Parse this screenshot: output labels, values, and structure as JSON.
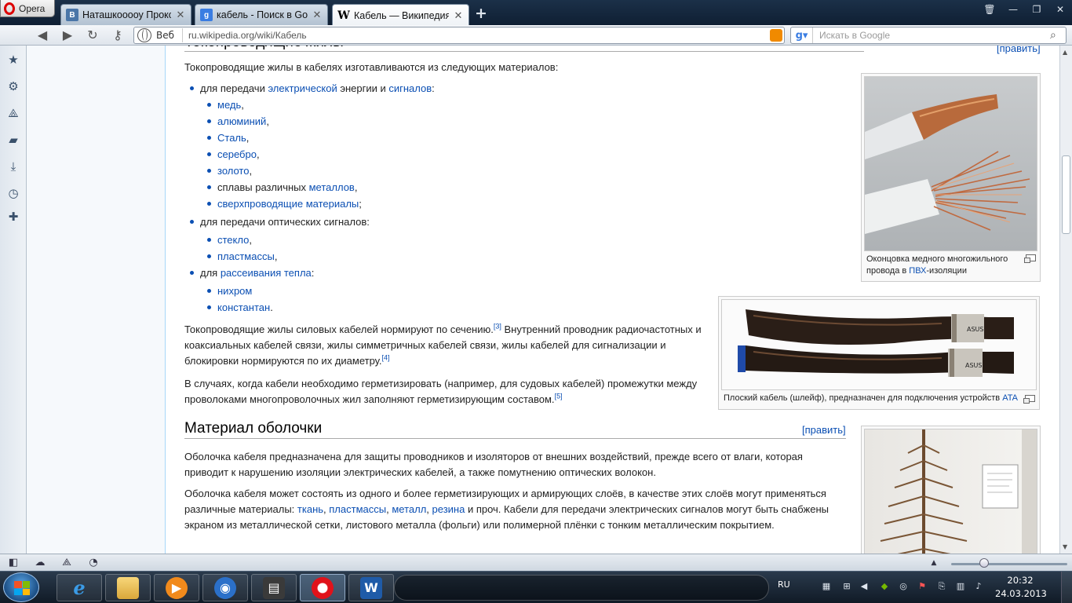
{
  "browser": {
    "menu_label": "Opera",
    "tabs": [
      {
        "label": "Наташкооооу Прокопь...",
        "icon": "vk-icon",
        "badge": "B",
        "color": "#4a76a8"
      },
      {
        "label": "кабель - Поиск в Goo...",
        "icon": "google-icon",
        "badge": "g",
        "color": "#3a7de2"
      },
      {
        "label": "Кабель — Википедия",
        "icon": "wikipedia-icon",
        "badge": "W",
        "color": "#ffffff"
      }
    ],
    "address": {
      "web_label": "Веб",
      "url_host": "ru.wikipedia.org",
      "url_path": "/wiki/Кабель"
    },
    "search": {
      "placeholder": "Искать в Google"
    }
  },
  "article": {
    "heading_top": "Токопроводящие жилы",
    "edit_label": "[править]",
    "intro": "Токопроводящие жилы в кабелях изготавливаются из следующих материалов:",
    "list": {
      "item1": {
        "pre": "для передачи ",
        "link1": "электрической",
        "mid": " энергии и ",
        "link2": "сигналов",
        "post": ":"
      },
      "sub1": [
        "медь",
        "алюминий",
        "Сталь",
        "серебро",
        "золото"
      ],
      "sub1_pre6": "сплавы различных ",
      "sub1_link6": "металлов",
      "sub1_last": "сверхпроводящие материалы",
      "item2": "для передачи оптических сигналов:",
      "sub2": [
        "стекло",
        "пластмассы"
      ],
      "item3": {
        "pre": "для ",
        "link": "рассеивания тепла",
        "post": ":"
      },
      "sub3": [
        "нихром",
        "константан"
      ]
    },
    "para1": {
      "a": "Токопроводящие жилы силовых кабелей нормируют по сечению.",
      "ref1": "[3]",
      "b": " Внутренний проводник радиочастотных и коаксиальных кабелей связи, жилы симметричных кабелей связи, жилы кабелей для сигнализации и блокировки нормируются по их диаметру.",
      "ref2": "[4]"
    },
    "para2": {
      "a": "В случаях, когда кабели необходимо герметизировать (например, для судовых кабелей) промежутки между проволоками многопроволочных жил заполняют герметизирующим составом.",
      "ref": "[5]"
    },
    "heading2": "Материал оболочки",
    "para3": "Оболочка кабеля предназначена для защиты проводников и изоляторов от внешних воздействий, прежде всего от влаги, которая приводит к нарушению изоляции электрических кабелей, а также помутнению оптических волокон.",
    "para4": {
      "a": "Оболочка кабеля может состоять из одного и более герметизирующих и армирующих слоёв, в качестве этих слоёв могут применяться различные материалы: ",
      "l1": "ткань",
      "l2": "пластмассы",
      "l3": "металл",
      "l4": "резина",
      "b": " и проч. Кабели для передачи электрических сигналов могут быть снабжены экраном из металлической сетки, листового металла (фольги) или полимерной плёнки с тонким металлическим покрытием."
    },
    "thumb1": {
      "caption_a": "Оконцовка медного многожильного провода в ",
      "caption_link": "ПВХ",
      "caption_b": "-изоляции"
    },
    "thumb2": {
      "caption_a": "Плоский кабель (шлейф), предназначен для подключения устройств ",
      "caption_link": "ATA",
      "ribbon_brand": "ASUS"
    }
  },
  "taskbar": {
    "lang": "RU",
    "time": "20:32",
    "date": "24.03.2013"
  }
}
